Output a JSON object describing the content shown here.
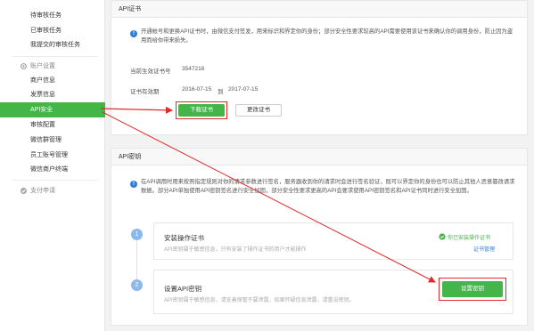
{
  "sidebar": {
    "items_top": [
      {
        "label": "待审核任务"
      },
      {
        "label": "已审核任务"
      },
      {
        "label": "我提交的审核任务"
      }
    ],
    "group_account": "账户设置",
    "items_account": [
      {
        "label": "商户信息"
      },
      {
        "label": "发票信息"
      },
      {
        "label": "API安全"
      },
      {
        "label": "审核配置"
      },
      {
        "label": "微信群管理"
      },
      {
        "label": "员工账号管理"
      },
      {
        "label": "微信商户终端"
      }
    ],
    "group_pay": "支付申请"
  },
  "cert_panel": {
    "title": "API证书",
    "notice": "开通帐号和更换API证书时，由微信支付签发，用来标识和界定你的身份；部分安全性要求较高的API需要使用该证书来确认你的调用身份，防止因为盗用而给你带来损失。",
    "serial_label": "当前生效证书号",
    "serial_value": "3547216",
    "validity_label": "证书有效期",
    "validity_from": "2016-07-15",
    "validity_to_word": "到",
    "validity_to": "2017-07-15",
    "download_button": "下载证书",
    "change_button": "更改证书"
  },
  "key_panel": {
    "title": "API密钥",
    "notice": "在API调用时用来按照指定规则对你的请求参数进行签名，服务器收到你的请求时会进行签名验证，既可以界定你的身份也可以防止其他人恶意篡改请求数据。部分API单独使用API密钥签名进行安全加固，部分安全性要求更高的API会要求使用API密钥签名和API证书同时进行安全加固。",
    "step1": {
      "number": "1",
      "title": "安装操作证书",
      "desc": "API密钥属于敏感信息，只有安装了操作证书的用户才能操作",
      "status": "你已安装操作证书",
      "link": "证书管理"
    },
    "step2": {
      "number": "2",
      "title": "设置API密钥",
      "desc": "API密钥属于敏感信息，请妥善保管不要泄露，如果怀疑信息泄露，请重设密钥。",
      "button": "设置密钥"
    }
  },
  "colors": {
    "accent_green": "#44b549",
    "annotation_red": "#e12b2b",
    "info_blue": "#2d7ed8"
  }
}
